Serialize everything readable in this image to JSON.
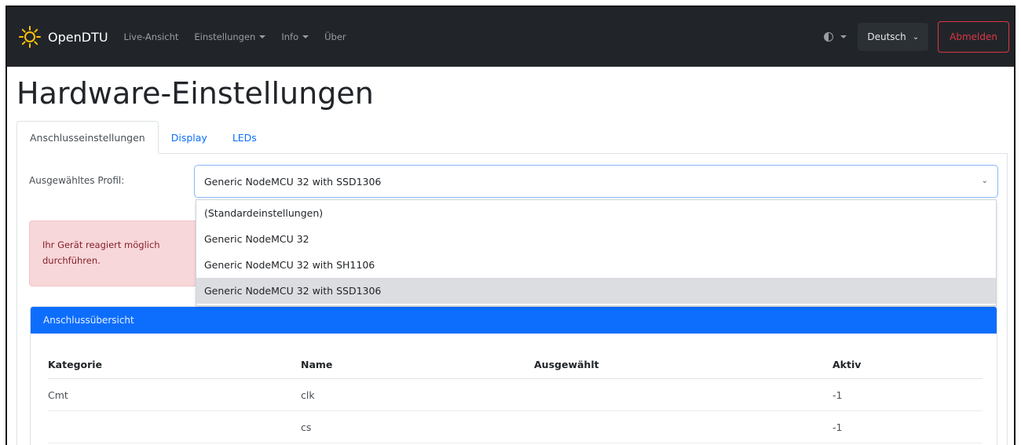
{
  "navbar": {
    "brand": "OpenDTU",
    "links": [
      "Live-Ansicht",
      "Einstellungen",
      "Info",
      "Über"
    ],
    "language": "Deutsch",
    "logout": "Abmelden"
  },
  "page_title": "Hardware-Einstellungen",
  "tabs": [
    "Anschlusseinstellungen",
    "Display",
    "LEDs"
  ],
  "profile": {
    "label": "Ausgewähltes Profil:",
    "selected": "Generic NodeMCU 32 with SSD1306",
    "options": [
      "(Standardeinstellungen)",
      "Generic NodeMCU 32",
      "Generic NodeMCU 32 with SH1106",
      "Generic NodeMCU 32 with SSD1306"
    ]
  },
  "alert": {
    "line1": "Ihr Gerät reagiert möglich",
    "line2": "durchführen."
  },
  "card": {
    "title": "Anschlussübersicht",
    "columns": [
      "Kategorie",
      "Name",
      "Ausgewählt",
      "Aktiv"
    ],
    "rows": [
      {
        "kategorie": "Cmt",
        "name": "clk",
        "ausgewaehlt": "",
        "aktiv": "-1"
      },
      {
        "kategorie": "",
        "name": "cs",
        "ausgewaehlt": "",
        "aktiv": "-1"
      }
    ]
  },
  "colors": {
    "navbar_bg": "#212529",
    "primary": "#0d6efd",
    "danger": "#dc3545",
    "alert_bg": "#f8d7da"
  }
}
